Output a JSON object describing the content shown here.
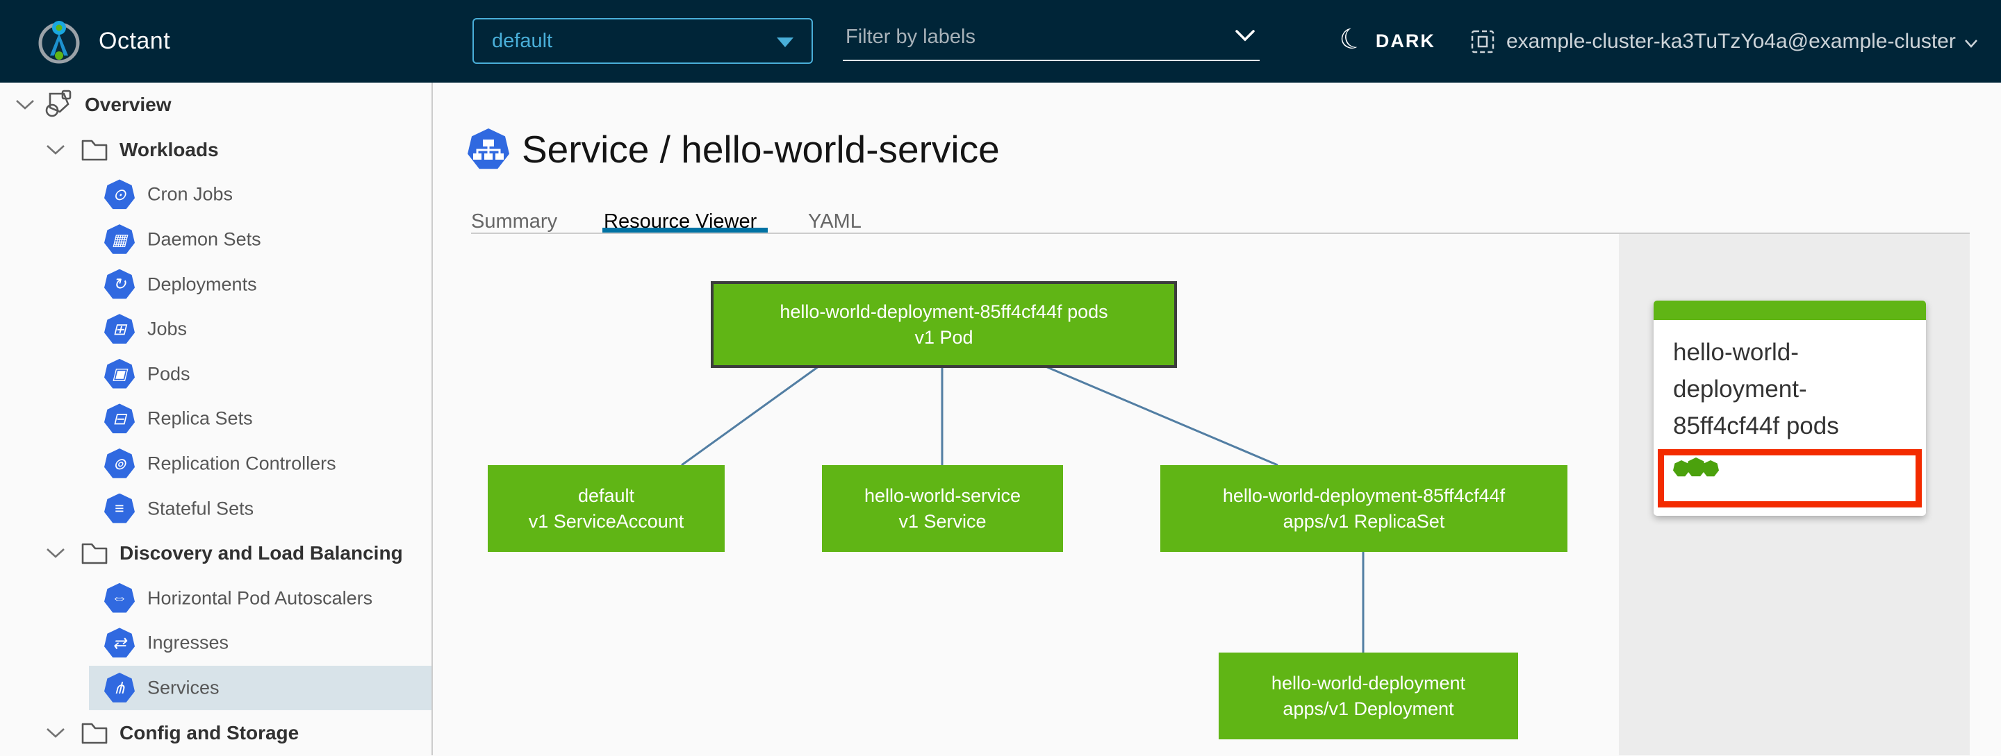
{
  "header": {
    "app_name": "Octant",
    "namespace_selector": {
      "value": "default"
    },
    "filter": {
      "placeholder": "Filter by labels"
    },
    "theme_toggle": {
      "label": "DARK"
    },
    "cluster_selector": {
      "label": "example-cluster-ka3TuTzYo4a@example-cluster"
    }
  },
  "sidebar": {
    "items": [
      {
        "label": "Overview",
        "level": 0,
        "icon": "objects-icon"
      },
      {
        "label": "Workloads",
        "level": 1,
        "icon": "folder-icon"
      },
      {
        "label": "Cron Jobs",
        "level": 2,
        "icon": "cronjob-icon",
        "glyph": "⊙"
      },
      {
        "label": "Daemon Sets",
        "level": 2,
        "icon": "daemonset-icon",
        "glyph": "▦"
      },
      {
        "label": "Deployments",
        "level": 2,
        "icon": "deployment-icon",
        "glyph": "↻"
      },
      {
        "label": "Jobs",
        "level": 2,
        "icon": "job-icon",
        "glyph": "⊞"
      },
      {
        "label": "Pods",
        "level": 2,
        "icon": "pod-icon",
        "glyph": "▣"
      },
      {
        "label": "Replica Sets",
        "level": 2,
        "icon": "replicaset-icon",
        "glyph": "⊟"
      },
      {
        "label": "Replication Controllers",
        "level": 2,
        "icon": "replicationcontroller-icon",
        "glyph": "⊚"
      },
      {
        "label": "Stateful Sets",
        "level": 2,
        "icon": "statefulset-icon",
        "glyph": "≡"
      },
      {
        "label": "Discovery and Load Balancing",
        "level": 1,
        "icon": "folder-icon"
      },
      {
        "label": "Horizontal Pod Autoscalers",
        "level": 2,
        "icon": "hpa-icon",
        "glyph": "⇔"
      },
      {
        "label": "Ingresses",
        "level": 2,
        "icon": "ingress-icon",
        "glyph": "⇄"
      },
      {
        "label": "Services",
        "level": 2,
        "icon": "service-icon",
        "glyph": "⋔",
        "selected": true
      },
      {
        "label": "Config and Storage",
        "level": 1,
        "icon": "folder-icon"
      }
    ]
  },
  "main": {
    "title": "Service / hello-world-service",
    "title_icon": "service-icon",
    "tabs": [
      {
        "label": "Summary",
        "active": false
      },
      {
        "label": "Resource Viewer",
        "active": true
      },
      {
        "label": "YAML",
        "active": false
      }
    ]
  },
  "graph": {
    "nodes": [
      {
        "id": "pod",
        "line1": "hello-world-deployment-85ff4cf44f pods",
        "line2": "v1 Pod",
        "selected": true
      },
      {
        "id": "serviceaccount",
        "line1": "default",
        "line2": "v1 ServiceAccount",
        "selected": false
      },
      {
        "id": "service",
        "line1": "hello-world-service",
        "line2": "v1 Service",
        "selected": false
      },
      {
        "id": "replicaset",
        "line1": "hello-world-deployment-85ff4cf44f",
        "line2": "apps/v1 ReplicaSet",
        "selected": false
      },
      {
        "id": "deployment",
        "line1": "hello-world-deployment",
        "line2": "apps/v1 Deployment",
        "selected": false
      }
    ],
    "edges": [
      {
        "from": "pod",
        "to": "serviceaccount"
      },
      {
        "from": "pod",
        "to": "service"
      },
      {
        "from": "pod",
        "to": "replicaset"
      },
      {
        "from": "replicaset",
        "to": "deployment"
      }
    ]
  },
  "preview_panel": {
    "title": "hello-world-deployment-85ff4cf44f pods",
    "pod_count": 3
  },
  "colors": {
    "header_bg": "#002538",
    "accent_blue": "#49afd9",
    "k8s_icon_blue": "#3069e0",
    "node_green": "#60b515",
    "selected_node_border": "#3c3c3c",
    "edge_blue": "#527ea3",
    "selection_red": "#f32b00",
    "pod_dot_green": "#4ba10d",
    "selected_row_bg": "#d8e3e9",
    "panel_bg": "#ececec",
    "active_tab_underline": "#0072a3"
  }
}
